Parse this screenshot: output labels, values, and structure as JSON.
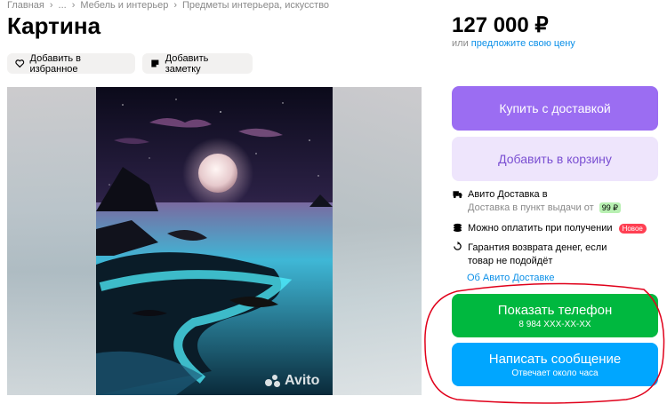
{
  "breadcrumb": {
    "items": [
      "Главная",
      "...",
      "Мебель и интерьер",
      "Предметы интерьера, искусство"
    ],
    "separator": "›"
  },
  "title": "Картина",
  "actions": {
    "favorite_label": "Добавить в избранное",
    "note_label": "Добавить заметку"
  },
  "gallery": {
    "watermark": "Avito"
  },
  "price": {
    "value": "127 000 ₽",
    "offer_prefix": "или",
    "offer_link": "предложите свою цену"
  },
  "buttons": {
    "buy": "Купить с доставкой",
    "cart": "Добавить в корзину",
    "phone_label": "Показать телефон",
    "phone_number": "8 984 XXX-XX-XX",
    "message_label": "Написать сообщение",
    "message_sub": "Отвечает около часа"
  },
  "delivery": {
    "title": "Авито Доставка в",
    "pickup": "Доставка в пункт выдачи от",
    "pickup_price": "99 ₽",
    "pay_on_receipt": "Можно оплатить при получении",
    "new_badge": "Новое",
    "guarantee": "Гарантия возврата денег, если товар не подойдёт",
    "about_link": "Об Авито Доставке"
  },
  "colors": {
    "buy": "#9b6df2",
    "cart_bg": "#eee5fc",
    "phone": "#00b83f",
    "message": "#00a6ff",
    "link": "#0a8fe8",
    "annotation": "#e0001a"
  },
  "icons": {
    "favorite": "heart-icon",
    "note": "note-icon",
    "truck": "truck-icon",
    "coins": "coins-icon",
    "guarantee": "check-arrow-icon"
  }
}
